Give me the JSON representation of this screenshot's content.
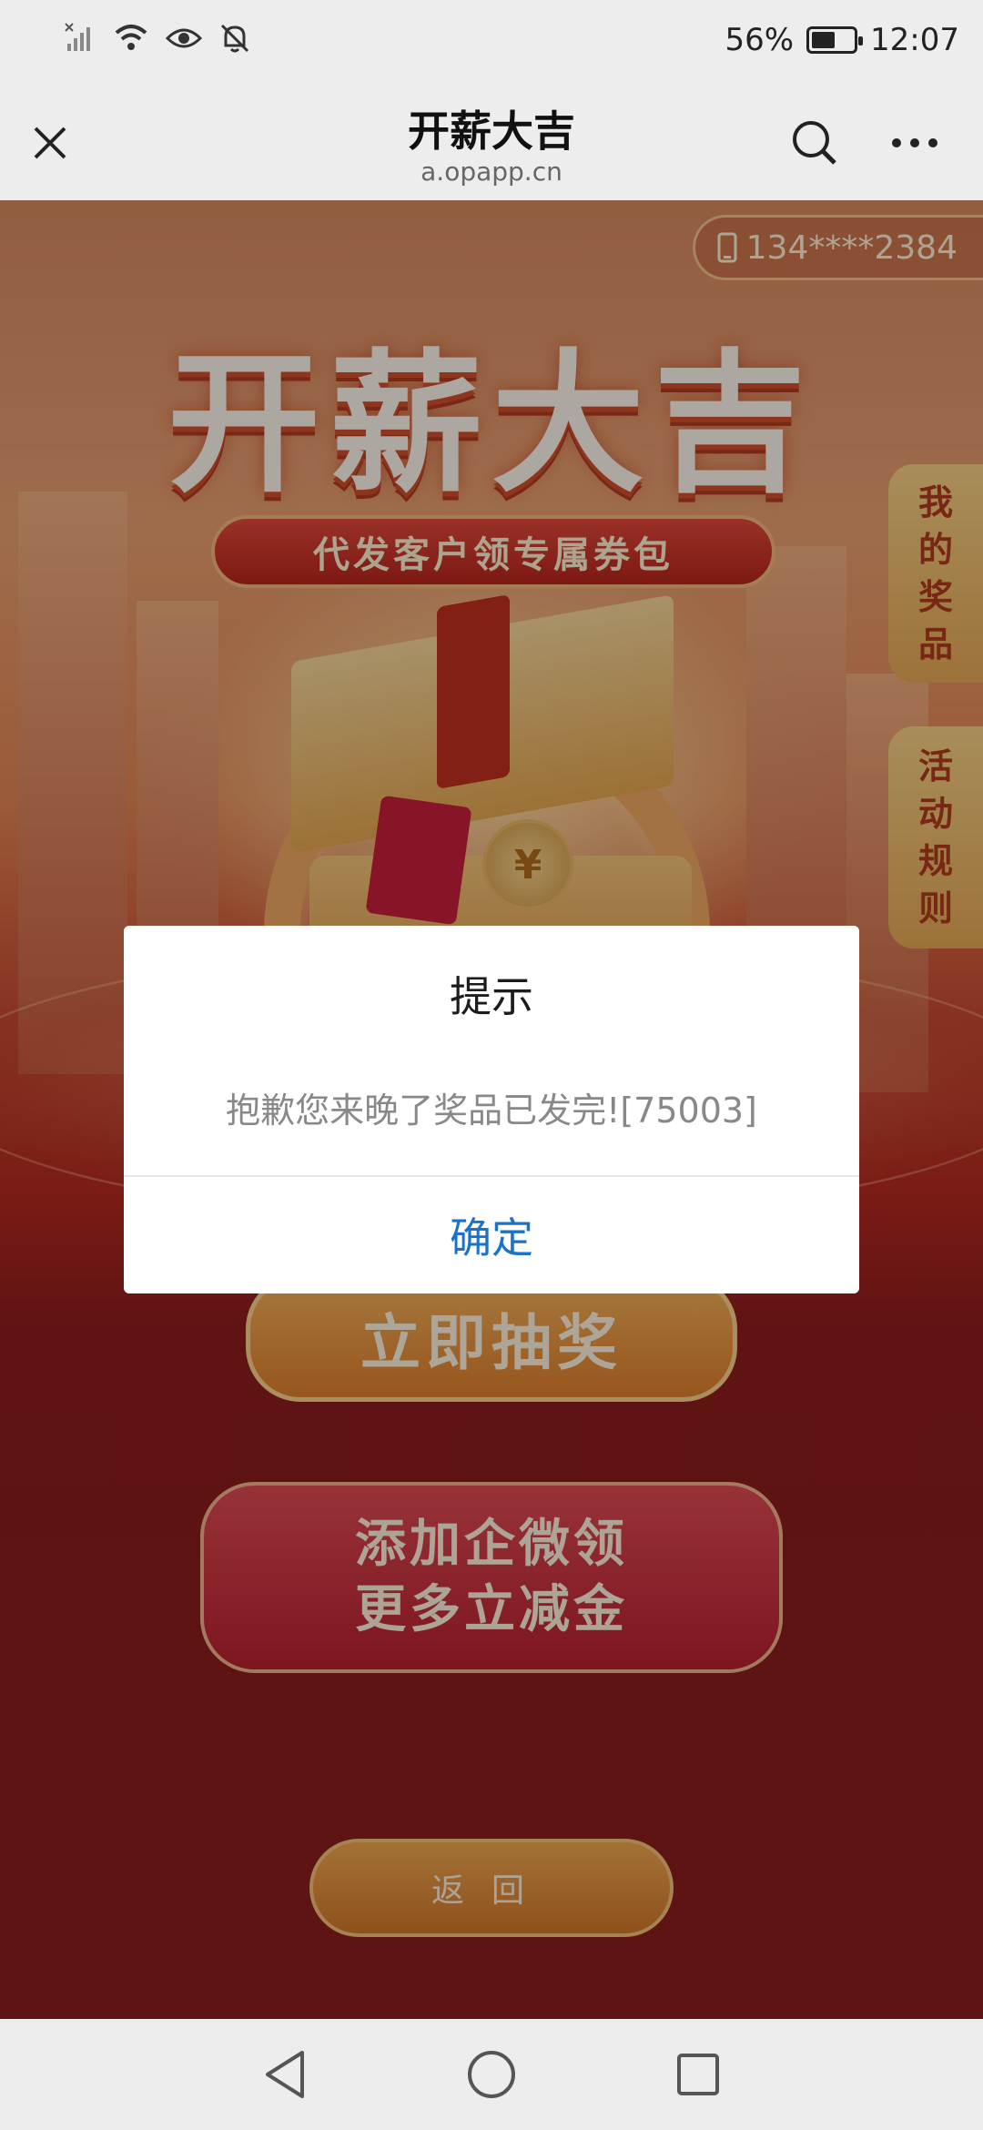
{
  "status_bar": {
    "battery_percent": "56%",
    "battery_level": 0.56,
    "time": "12:07",
    "icons": [
      "signal-off-icon",
      "wifi-icon",
      "eye-icon",
      "bell-off-icon"
    ]
  },
  "navbar": {
    "title": "开薪大吉",
    "url": "a.opapp.cn",
    "close_icon": "close-icon",
    "search_icon": "search-icon",
    "more_icon": "more-icon"
  },
  "page": {
    "phone_masked": "134****2384",
    "hero_title": "开薪大吉",
    "subtitle": "代发客户领专属券包",
    "side_tabs": {
      "my_prizes": [
        "我",
        "的",
        "奖",
        "品"
      ],
      "rules": [
        "活",
        "动",
        "规",
        "则"
      ]
    },
    "coin_symbol": "¥",
    "draw_button": "立即抽奖",
    "wecom_button_line1": "添加企微领",
    "wecom_button_line2": "更多立减金",
    "back_button": "返回"
  },
  "dialog": {
    "title": "提示",
    "message": "抱歉您来晚了奖品已发完![75003]",
    "confirm": "确定"
  },
  "colors": {
    "accent_blue": "#1a73c8",
    "page_red": "#8a1e1d"
  }
}
